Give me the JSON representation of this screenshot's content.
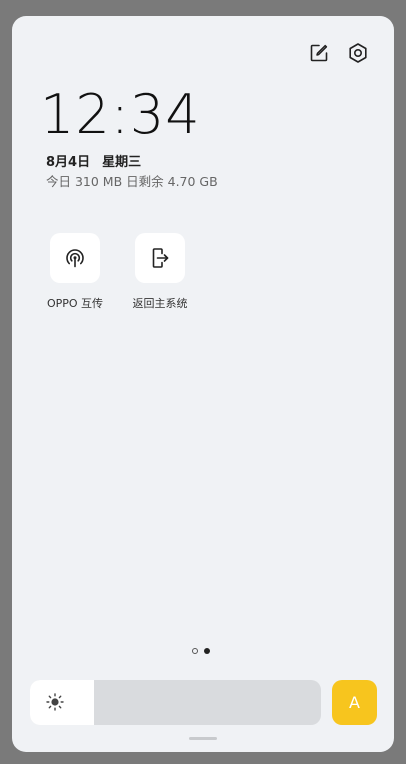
{
  "header": {
    "edit_icon": "edit-icon",
    "settings_icon": "gear-icon"
  },
  "clock": {
    "time": "12:34",
    "date": "8月4日",
    "weekday": "星期三",
    "data_usage": "今日 310 MB 日剩余 4.70 GB"
  },
  "apps": [
    {
      "label": "OPPO 互传",
      "icon": "share-signal-icon"
    },
    {
      "label": "返回主系统",
      "icon": "exit-phone-icon"
    }
  ],
  "pager": {
    "total": 2,
    "current": 2
  },
  "brightness": {
    "level": 0.22,
    "icon": "sun-icon"
  },
  "auto_brightness": {
    "label": "A",
    "color": "#f7c51e"
  }
}
